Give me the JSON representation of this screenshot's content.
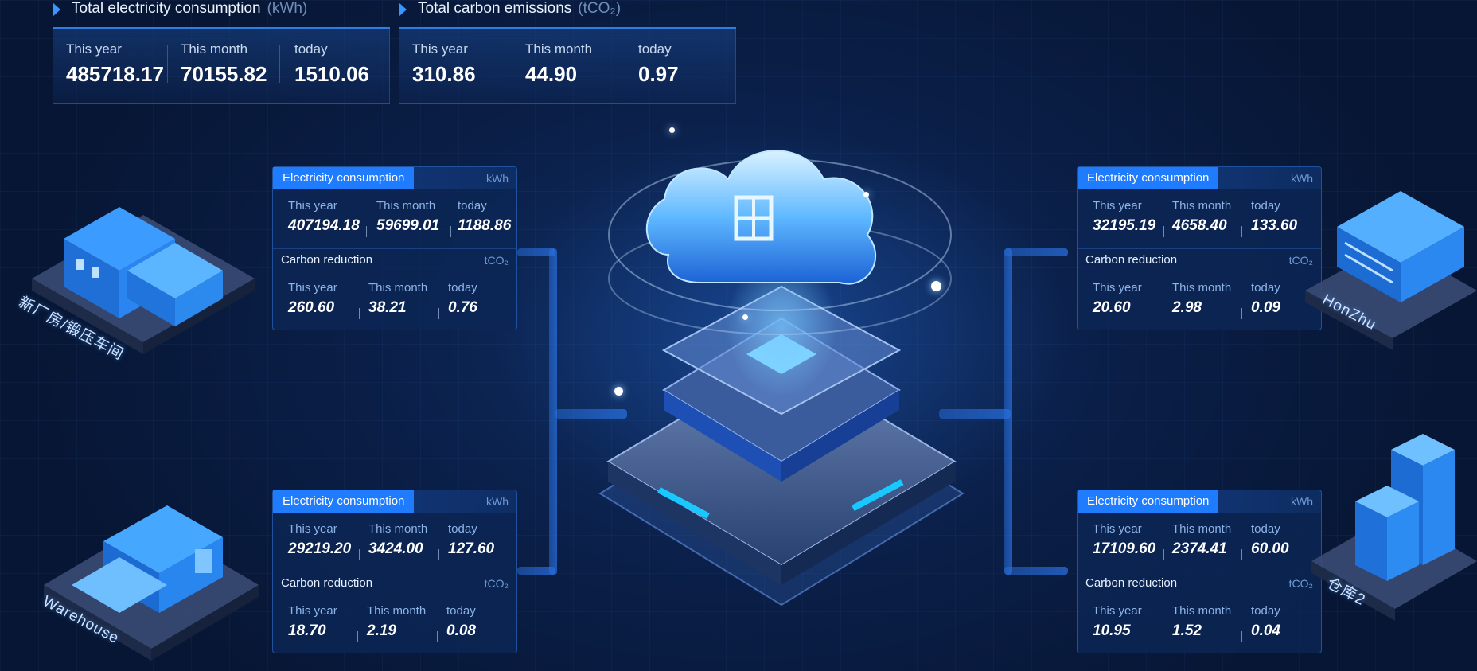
{
  "summary": {
    "electricity": {
      "title": "Total electricity consumption",
      "unit": "(kWh)",
      "items": [
        {
          "label": "This year",
          "value": "485718.17"
        },
        {
          "label": "This month",
          "value": "70155.82"
        },
        {
          "label": "today",
          "value": "1510.06"
        }
      ]
    },
    "carbon": {
      "title": "Total carbon emissions",
      "unit": "(tCO₂)",
      "items": [
        {
          "label": "This year",
          "value": "310.86"
        },
        {
          "label": "This month",
          "value": "44.90"
        },
        {
          "label": "today",
          "value": "0.97"
        }
      ]
    }
  },
  "cards": [
    {
      "site": "新厂房/锻压车间",
      "elec": {
        "title": "Electricity consumption",
        "unit": "kWh",
        "items": [
          {
            "label": "This year",
            "value": "407194.18"
          },
          {
            "label": "This month",
            "value": "59699.01"
          },
          {
            "label": "today",
            "value": "1188.86"
          }
        ]
      },
      "carbon": {
        "title": "Carbon reduction",
        "unit": "tCO₂",
        "items": [
          {
            "label": "This year",
            "value": "260.60"
          },
          {
            "label": "This month",
            "value": "38.21"
          },
          {
            "label": "today",
            "value": "0.76"
          }
        ]
      }
    },
    {
      "site": "Warehouse",
      "elec": {
        "title": "Electricity consumption",
        "unit": "kWh",
        "items": [
          {
            "label": "This year",
            "value": "29219.20"
          },
          {
            "label": "This month",
            "value": "3424.00"
          },
          {
            "label": "today",
            "value": "127.60"
          }
        ]
      },
      "carbon": {
        "title": "Carbon reduction",
        "unit": "tCO₂",
        "items": [
          {
            "label": "This year",
            "value": "18.70"
          },
          {
            "label": "This month",
            "value": "2.19"
          },
          {
            "label": "today",
            "value": "0.08"
          }
        ]
      }
    },
    {
      "site": "HonZhu",
      "elec": {
        "title": "Electricity consumption",
        "unit": "kWh",
        "items": [
          {
            "label": "This year",
            "value": "32195.19"
          },
          {
            "label": "This month",
            "value": "4658.40"
          },
          {
            "label": "today",
            "value": "133.60"
          }
        ]
      },
      "carbon": {
        "title": "Carbon reduction",
        "unit": "tCO₂",
        "items": [
          {
            "label": "This year",
            "value": "20.60"
          },
          {
            "label": "This month",
            "value": "2.98"
          },
          {
            "label": "today",
            "value": "0.09"
          }
        ]
      }
    },
    {
      "site": "仓库2",
      "elec": {
        "title": "Electricity consumption",
        "unit": "kWh",
        "items": [
          {
            "label": "This year",
            "value": "17109.60"
          },
          {
            "label": "This month",
            "value": "2374.41"
          },
          {
            "label": "today",
            "value": "60.00"
          }
        ]
      },
      "carbon": {
        "title": "Carbon reduction",
        "unit": "tCO₂",
        "items": [
          {
            "label": "This year",
            "value": "10.95"
          },
          {
            "label": "This month",
            "value": "1.52"
          },
          {
            "label": "today",
            "value": "0.04"
          }
        ]
      }
    }
  ],
  "center": {
    "icon": "cloud-platform-icon"
  },
  "colors": {
    "accent": "#1f7cff",
    "background": "#0a1e46",
    "panel": "#0c2656"
  }
}
